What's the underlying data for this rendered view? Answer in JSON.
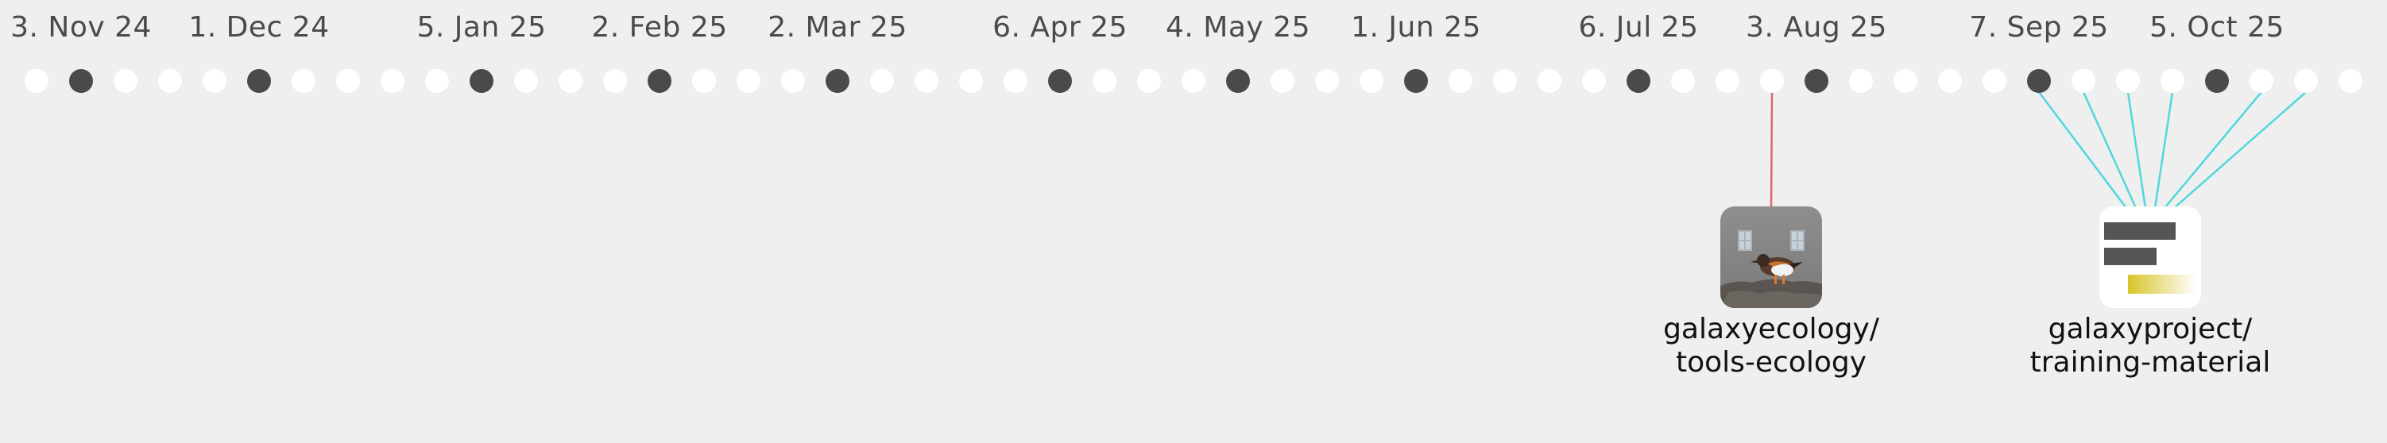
{
  "timeline": {
    "date_labels": [
      {
        "text": "3. Nov 24",
        "dot_index": 1
      },
      {
        "text": "1. Dec 24",
        "dot_index": 5
      },
      {
        "text": "5. Jan 25",
        "dot_index": 10
      },
      {
        "text": "2. Feb 25",
        "dot_index": 14
      },
      {
        "text": "2. Mar 25",
        "dot_index": 18
      },
      {
        "text": "6. Apr 25",
        "dot_index": 23
      },
      {
        "text": "4. May 25",
        "dot_index": 27
      },
      {
        "text": "1. Jun 25",
        "dot_index": 31
      },
      {
        "text": "6. Jul 25",
        "dot_index": 36
      },
      {
        "text": "3. Aug 25",
        "dot_index": 40
      },
      {
        "text": "7. Sep 25",
        "dot_index": 45
      },
      {
        "text": "5. Oct 25",
        "dot_index": 49
      }
    ],
    "dot_count": 53,
    "filled_dots": [
      1,
      5,
      10,
      14,
      18,
      23,
      27,
      31,
      36,
      40,
      45,
      49
    ],
    "colors": {
      "background": "#efefef",
      "dot_empty": "#ffffff",
      "dot_filled": "#4a4a4a",
      "label_text": "#4a4a4a",
      "repo_text": "#111111"
    }
  },
  "repositories": [
    {
      "name_line1": "galaxyecology/",
      "name_line2": "tools-ecology",
      "icon": "bird-photo-icon",
      "link_color": "#e06666",
      "linked_dots": [
        39
      ]
    },
    {
      "name_line1": "galaxyproject/",
      "name_line2": "training-material",
      "icon": "training-material-logo-icon",
      "link_color": "#4fd8dc",
      "linked_dots": [
        45,
        46,
        47,
        48,
        50,
        51
      ]
    }
  ]
}
